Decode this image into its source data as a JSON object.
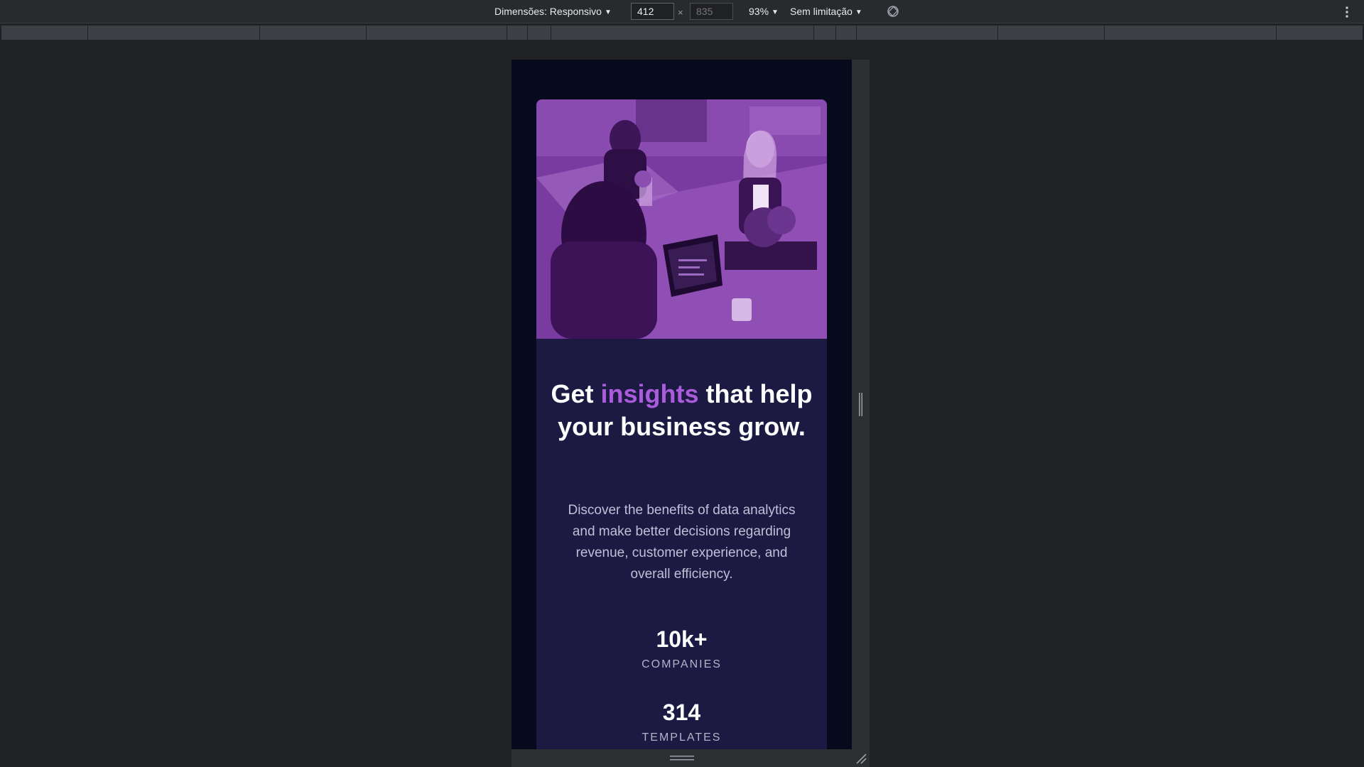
{
  "toolbar": {
    "dimensions_label": "Dimensões: Responsivo",
    "width_value": "412",
    "height_placeholder": "835",
    "times_symbol": "×",
    "zoom_label": "93%",
    "throttle_label": "Sem limitação",
    "rotate_icon": "rotate-icon",
    "more_icon": "kebab-menu-icon"
  },
  "page": {
    "headline": {
      "part1": "Get ",
      "accent": "insights",
      "part2": " that help your business grow."
    },
    "description": "Discover the benefits of data analytics and make better decisions regarding revenue, customer experience, and overall efficiency.",
    "stats": [
      {
        "value": "10k+",
        "label": "COMPANIES"
      },
      {
        "value": "314",
        "label": "TEMPLATES"
      }
    ],
    "colors": {
      "background": "#070a1d",
      "card": "#1c1a43",
      "accent": "#aa5cdb",
      "text_muted": "#c1bfd6"
    }
  }
}
